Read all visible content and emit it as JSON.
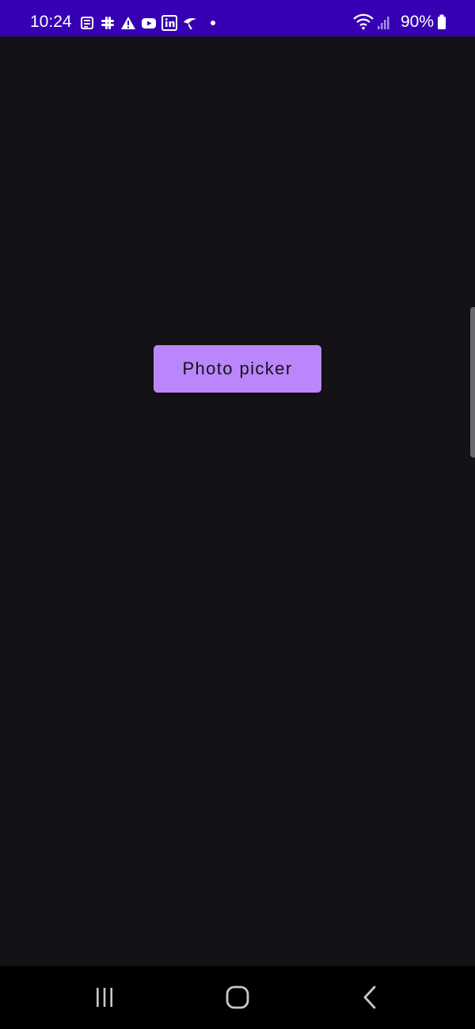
{
  "status_bar": {
    "time": "10:24",
    "battery_percent": "90%",
    "notification_icons": [
      "news-icon",
      "slack-icon",
      "warning-icon",
      "youtube-icon",
      "linkedin-icon",
      "telenor-icon"
    ],
    "background_color": "#3700b3"
  },
  "main": {
    "photo_picker_label": "Photo picker",
    "button_color": "#bb86fc",
    "background_color": "#141216"
  },
  "nav_bar": {
    "buttons": [
      "recent-apps",
      "home",
      "back"
    ]
  }
}
